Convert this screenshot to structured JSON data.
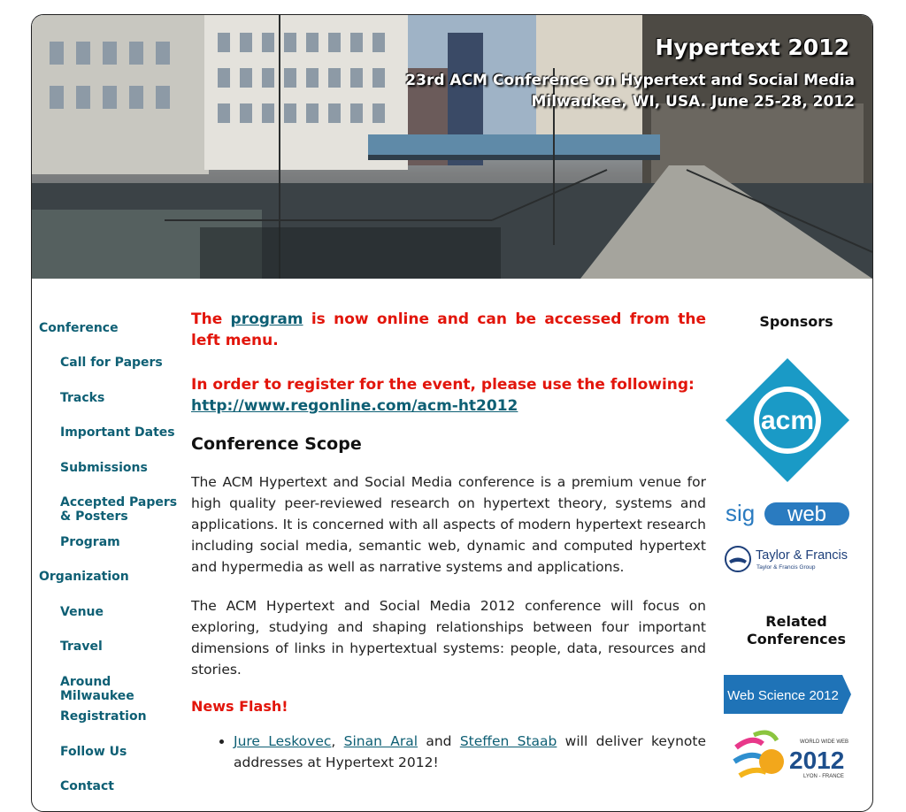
{
  "banner": {
    "title": "Hypertext 2012",
    "subtitle_line1": "23rd ACM Conference on Hypertext and Social Media",
    "subtitle_line2": "Milwaukee, WI, USA. June 25-28, 2012"
  },
  "menu": {
    "conference": "Conference",
    "call_for_papers": "Call for Papers",
    "tracks": "Tracks",
    "important_dates": "Important Dates",
    "submissions": "Submissions",
    "accepted_papers": "Accepted Papers & Posters",
    "program": "Program",
    "organization": "Organization",
    "venue": "Venue",
    "travel": "Travel",
    "around_milwaukee": "Around Milwaukee",
    "registration": "Registration",
    "follow_us": "Follow Us",
    "contact": "Contact"
  },
  "main": {
    "alert1_pre": "The ",
    "alert1_link": "program",
    "alert1_post": " is now online and can be accessed from the left menu.",
    "alert2_text": "In order to register for the event, please use the following:",
    "alert2_link": "http://www.regonline.com/acm-ht2012",
    "scope_heading": "Conference Scope",
    "scope_para1": "The ACM Hypertext and Social Media conference is a premium venue for high quality peer-reviewed research on hypertext theory, systems and applications. It is concerned with all aspects of modern hypertext research including social media, semantic web, dynamic and computed hypertext and hypermedia as well as narrative systems and applications.",
    "scope_para2": "The ACM Hypertext and Social Media 2012 conference will focus on exploring, studying and shaping relationships between four important dimensions of links in hypertextual systems: people, data, resources and stories.",
    "news_heading": "News Flash!",
    "news1_link1": "Jure Leskovec",
    "news1_sep1": ", ",
    "news1_link2": "Sinan Aral",
    "news1_sep2": " and ",
    "news1_link3": "Steffen Staab",
    "news1_text": " will deliver keynote addresses at Hypertext 2012!"
  },
  "right": {
    "sponsors_heading": "Sponsors",
    "acm_logo_text": "acm",
    "sigweb_sig": "sig",
    "sigweb_web": "web",
    "tf_name": "Taylor & Francis",
    "tf_group": "Taylor & Francis Group",
    "related_heading": "Related Conferences",
    "webscience_text": "Web Science 2012",
    "www_small": "WORLD WIDE WEB",
    "www_year": "2012",
    "www_place": "LYON - FRANCE"
  },
  "colors": {
    "link": "#0e5f74",
    "alert": "#e2150b",
    "acm_blue": "#1a9ac6",
    "sigweb_blue": "#2a7bc0",
    "webscience_blue": "#1f73b7"
  }
}
